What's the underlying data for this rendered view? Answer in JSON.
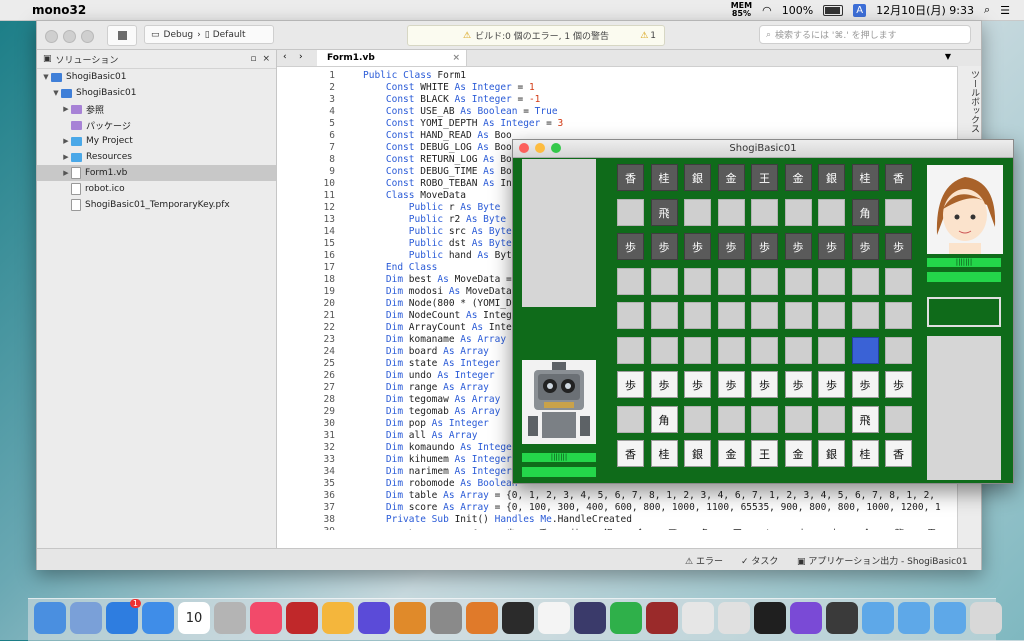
{
  "menubar": {
    "app_name": "mono32",
    "mem_label": "MEM",
    "mem_value": "85%",
    "battery_text": "100%",
    "input_mode": "A",
    "datetime": "12月10日(月)  9:33"
  },
  "ide": {
    "config": "Debug",
    "target": "Default",
    "build_status": "ビルド:0 個のエラー, 1 個の警告",
    "warning_count": "1",
    "search_placeholder": "検索するには '⌘.' を押します",
    "solution_title": "ソリューション",
    "tree": [
      {
        "label": "ShogiBasic01",
        "depth": 0,
        "arrow": "▼",
        "icon": "solution-icon"
      },
      {
        "label": "ShogiBasic01",
        "depth": 1,
        "arrow": "▼",
        "icon": "project-icon"
      },
      {
        "label": "参照",
        "depth": 2,
        "arrow": "▶",
        "icon": "references-folder-icon"
      },
      {
        "label": "パッケージ",
        "depth": 2,
        "arrow": "",
        "icon": "packages-folder-icon"
      },
      {
        "label": "My Project",
        "depth": 2,
        "arrow": "▶",
        "icon": "folder-icon"
      },
      {
        "label": "Resources",
        "depth": 2,
        "arrow": "▶",
        "icon": "folder-icon"
      },
      {
        "label": "Form1.vb",
        "depth": 2,
        "arrow": "▶",
        "icon": "vb-file-icon",
        "selected": true
      },
      {
        "label": "robot.ico",
        "depth": 2,
        "arrow": "",
        "icon": "file-icon"
      },
      {
        "label": "ShogiBasic01_TemporaryKey.pfx",
        "depth": 2,
        "arrow": "",
        "icon": "file-icon"
      }
    ],
    "tab_label": "Form1.vb",
    "right_sidebar_label": "ツールボックス",
    "code_lines": [
      "Public Class Form1",
      "    Const WHITE As Integer = 1",
      "    Const BLACK As Integer = -1",
      "    Const USE_AB As Boolean = True",
      "    Const YOMI_DEPTH As Integer = 3",
      "    Const HAND_READ As Boo",
      "    Const DEBUG_LOG As Boo",
      "    Const RETURN_LOG As Bo",
      "    Const DEBUG_TIME As Bo",
      "    Const ROBO_TEBAN As In",
      "    Class MoveData",
      "        Public r As Byte",
      "        Public r2 As Byte",
      "        Public src As Byte",
      "        Public dst As Byte",
      "        Public hand As Byt",
      "    End Class",
      "    Dim best As MoveData =",
      "    Dim modosi As MoveData",
      "    Dim Node(800 * (YOMI_D",
      "    Dim NodeCount As Integ",
      "    Dim ArrayCount As Inte",
      "    Dim komaname As Array",
      "    Dim board As Array",
      "    Dim state As Integer",
      "    Dim undo As Integer",
      "    Dim range As Array",
      "    Dim tegomaw As Array",
      "    Dim tegomab As Array",
      "    Dim pop As Integer",
      "    Dim all As Array",
      "    Dim komaundo As Integer",
      "    Dim kihumem As Integer",
      "    Dim narimem As Integer",
      "    Dim robomode As Boolean",
      "    Dim table As Array = {0, 1, 2, 3, 4, 5, 6, 7, 8, 1, 2, 3, 4, 6, 7, 1, 2, 3, 4, 5, 6, 7, 8, 1, 2,",
      "    Dim score As Array = {0, 100, 300, 400, 600, 800, 1000, 1100, 65535, 900, 800, 800, 1000, 1200, 1",
      "    Private Sub Init() Handles Me.HandleCreated",
      "        komaname = {\"\", \"歩\", \"香\", \"桂\", \"銀\", \"金\", \"飛\", \"角\", \"王\", \"と\", \"杏\", \"圭\", \"全\", \"龍\", \"馬\""
    ],
    "status_errors": "エラー",
    "status_tasks": "タスク",
    "status_output": "アプリケーション出力 - ShogiBasic01"
  },
  "game": {
    "title": "ShogiBasic01",
    "robot_label": "|||||||",
    "human_label": "|||||||",
    "board": [
      [
        [
          "g",
          "香"
        ],
        [
          "g",
          "桂"
        ],
        [
          "g",
          "銀"
        ],
        [
          "g",
          "金"
        ],
        [
          "g",
          "王"
        ],
        [
          "g",
          "金"
        ],
        [
          "g",
          "銀"
        ],
        [
          "g",
          "桂"
        ],
        [
          "g",
          "香"
        ]
      ],
      [
        [
          "e",
          ""
        ],
        [
          "g",
          "飛"
        ],
        [
          "e",
          ""
        ],
        [
          "e",
          ""
        ],
        [
          "e",
          ""
        ],
        [
          "e",
          ""
        ],
        [
          "e",
          ""
        ],
        [
          "g",
          "角"
        ],
        [
          "e",
          ""
        ]
      ],
      [
        [
          "g",
          "歩"
        ],
        [
          "g",
          "歩"
        ],
        [
          "g",
          "歩"
        ],
        [
          "g",
          "歩"
        ],
        [
          "g",
          "歩"
        ],
        [
          "g",
          "歩"
        ],
        [
          "g",
          "歩"
        ],
        [
          "g",
          "歩"
        ],
        [
          "g",
          "歩"
        ]
      ],
      [
        [
          "e",
          ""
        ],
        [
          "e",
          ""
        ],
        [
          "e",
          ""
        ],
        [
          "e",
          ""
        ],
        [
          "e",
          ""
        ],
        [
          "e",
          ""
        ],
        [
          "e",
          ""
        ],
        [
          "e",
          ""
        ],
        [
          "e",
          ""
        ]
      ],
      [
        [
          "e",
          ""
        ],
        [
          "e",
          ""
        ],
        [
          "e",
          ""
        ],
        [
          "e",
          ""
        ],
        [
          "e",
          ""
        ],
        [
          "e",
          ""
        ],
        [
          "e",
          ""
        ],
        [
          "e",
          ""
        ],
        [
          "e",
          ""
        ]
      ],
      [
        [
          "e",
          ""
        ],
        [
          "e",
          ""
        ],
        [
          "e",
          ""
        ],
        [
          "e",
          ""
        ],
        [
          "e",
          ""
        ],
        [
          "e",
          ""
        ],
        [
          "e",
          ""
        ],
        [
          "h",
          ""
        ],
        [
          "e",
          ""
        ]
      ],
      [
        [
          "s",
          "歩"
        ],
        [
          "s",
          "歩"
        ],
        [
          "s",
          "歩"
        ],
        [
          "s",
          "歩"
        ],
        [
          "s",
          "歩"
        ],
        [
          "s",
          "歩"
        ],
        [
          "s",
          "歩"
        ],
        [
          "s",
          "歩"
        ],
        [
          "s",
          "歩"
        ]
      ],
      [
        [
          "e",
          ""
        ],
        [
          "s",
          "角"
        ],
        [
          "e",
          ""
        ],
        [
          "e",
          ""
        ],
        [
          "e",
          ""
        ],
        [
          "e",
          ""
        ],
        [
          "e",
          ""
        ],
        [
          "s",
          "飛"
        ],
        [
          "e",
          ""
        ]
      ],
      [
        [
          "s",
          "香"
        ],
        [
          "s",
          "桂"
        ],
        [
          "s",
          "銀"
        ],
        [
          "s",
          "金"
        ],
        [
          "s",
          "王"
        ],
        [
          "s",
          "金"
        ],
        [
          "s",
          "銀"
        ],
        [
          "s",
          "桂"
        ],
        [
          "s",
          "香"
        ]
      ]
    ]
  },
  "dock": {
    "mail_badge": "1",
    "calendar_day": "10"
  }
}
